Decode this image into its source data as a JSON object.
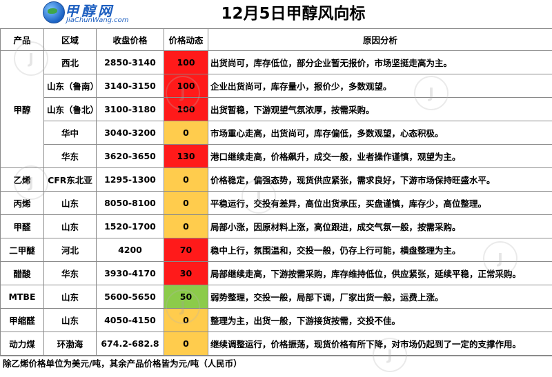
{
  "brand": {
    "logo_text": "甲醇网",
    "site": "JiaChunWang.com"
  },
  "title": "12月5日甲醇风向标",
  "headers": {
    "product": "产品",
    "region": "区域",
    "price": "收盘价格",
    "dynamic": "价格动态",
    "reason": "原因分析"
  },
  "colors": {
    "red": "#ff1a1a",
    "yellow": "#ffcc4d",
    "green": "#8ccb4a"
  },
  "rows": [
    {
      "product": "甲醇",
      "region": "西北",
      "price": "2850-3140",
      "dynamic": "100",
      "level": "red",
      "reason": "出货尚可，库存低位，部分企业暂无报价，市场坚挺走高为主。"
    },
    {
      "product": "",
      "region": "山东（鲁南）",
      "price": "3140-3150",
      "dynamic": "100",
      "level": "red",
      "reason": "企业出货尚可，库存量小，报价少，多数观望。"
    },
    {
      "product": "",
      "region": "山东（鲁北）",
      "price": "3100-3180",
      "dynamic": "100",
      "level": "red",
      "reason": "出货暂稳，下游观望气氛浓厚，按需采购。"
    },
    {
      "product": "",
      "region": "华中",
      "price": "3040-3200",
      "dynamic": "0",
      "level": "yellow",
      "reason": "市场重心走高，出货尚可，库存偏低，多数观望，心态积极。"
    },
    {
      "product": "",
      "region": "华东",
      "price": "3620-3650",
      "dynamic": "130",
      "level": "red",
      "reason": "港口继续走高，价格飙升，成交一般，业者操作谨慎，观望为主。"
    },
    {
      "product": "乙烯",
      "region": "CFR东北亚",
      "price": "1295-1300",
      "dynamic": "0",
      "level": "yellow",
      "reason": "价格稳定，偏强态势，现货供应紧张，需求良好，下游市场保持旺盛水平。"
    },
    {
      "product": "丙烯",
      "region": "山东",
      "price": "8050-8100",
      "dynamic": "0",
      "level": "yellow",
      "reason": "平稳运行，交投有差异，高位出货承压，买盘谨慎，库存少，高位整理。"
    },
    {
      "product": "甲醛",
      "region": "山东",
      "price": "1520-1700",
      "dynamic": "0",
      "level": "yellow",
      "reason": "局部小涨，因原材料上涨，高位跟进，成交气氛一般，按需采购。"
    },
    {
      "product": "二甲醚",
      "region": "河北",
      "price": "4200",
      "dynamic": "70",
      "level": "red",
      "reason": "稳中上行，氛围温和，交投一般，仍存上行可能，横盘整理为主。"
    },
    {
      "product": "醋酸",
      "region": "华东",
      "price": "3930-4170",
      "dynamic": "30",
      "level": "red",
      "reason": "局部继续走高，下游按需采购，库存维持低位，供应紧张，延续平稳，正常采购。"
    },
    {
      "product": "MTBE",
      "region": "山东",
      "price": "5600-5650",
      "dynamic": "50",
      "level": "green",
      "reason": "弱势整理，交投一般，局部下调，厂家出货一般，运费上涨。"
    },
    {
      "product": "甲缩醛",
      "region": "山东",
      "price": "4050-4150",
      "dynamic": "0",
      "level": "yellow",
      "reason": "整理为主，出货一般，下游接货按需，交投不佳。"
    },
    {
      "product": "动力煤",
      "region": "环渤海",
      "price": "674.2-682.8",
      "dynamic": "0",
      "level": "yellow",
      "reason": "继续调整运行，价格振荡，现货价格有所下降，对市场仍起到了一定的支撑作用。"
    }
  ],
  "footer": "除乙烯价格单位为美元/吨，其余产品价格皆为元/吨（人民币）"
}
